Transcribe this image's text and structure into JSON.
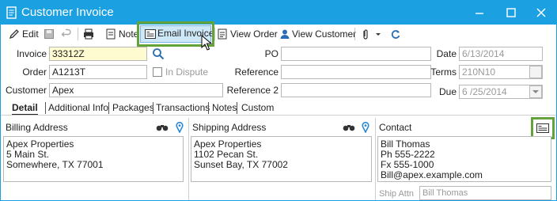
{
  "window": {
    "title": "Customer Invoice"
  },
  "toolbar": {
    "edit": "Edit",
    "note": "Note",
    "email_invoice": "Email Invoice",
    "view_order": "View Order",
    "view_customer": "View Customer"
  },
  "form": {
    "invoice": {
      "label": "Invoice",
      "value": "33312Z"
    },
    "order": {
      "label": "Order",
      "value": "A1213T"
    },
    "customer": {
      "label": "Customer",
      "value": "Apex"
    },
    "in_dispute": {
      "label": "In Dispute",
      "checked": false
    },
    "po": {
      "label": "PO",
      "value": ""
    },
    "reference": {
      "label": "Reference",
      "value": ""
    },
    "reference2": {
      "label": "Reference 2",
      "value": ""
    },
    "date": {
      "label": "Date",
      "value": "6/13/2014"
    },
    "terms": {
      "label": "Terms",
      "value": "210N10"
    },
    "due": {
      "label": "Due",
      "value": "6 /25/2014"
    }
  },
  "tabs": [
    "Detail",
    "Additional Info",
    "Packages",
    "Transactions",
    "Notes",
    "Custom"
  ],
  "billing": {
    "title": "Billing Address",
    "lines": [
      "Apex Properties",
      "5 Main St.",
      "Somewhere, TX 77001"
    ]
  },
  "shipping": {
    "title": "Shipping Address",
    "lines": [
      "Apex Properties",
      "1102 Pecan St.",
      "Sunset Bay, TX 77002"
    ]
  },
  "contact": {
    "title": "Contact",
    "lines": [
      "Bill Thomas",
      "Ph 555-2222",
      "Fx 555-1000",
      "Bill@apex.example.com"
    ],
    "ship_attn_label": "Ship Attn",
    "ship_attn_value": "Bill Thomas"
  },
  "colors": {
    "titlebar": "#1ba1e2",
    "highlight": "#63a33a",
    "required_field": "#fffbd0"
  }
}
